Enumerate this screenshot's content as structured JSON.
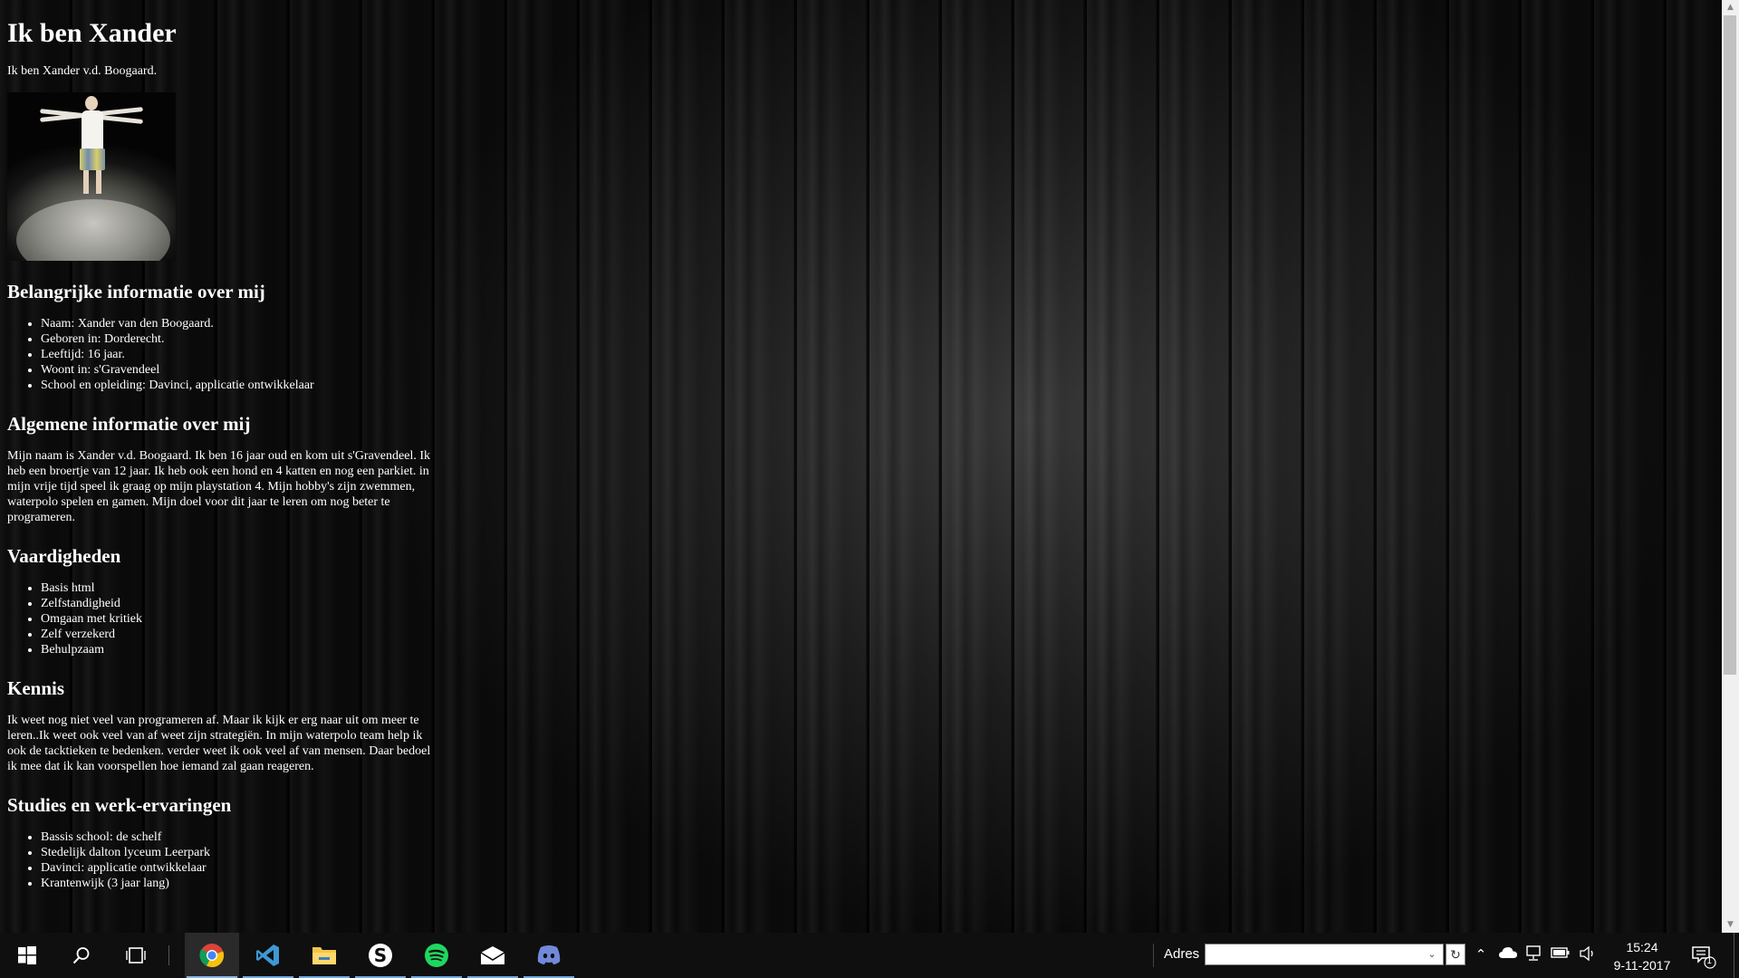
{
  "page": {
    "title": "Ik ben Xander",
    "intro": "Ik ben Xander v.d. Boogaard.",
    "sections": {
      "belangrijk": {
        "heading": "Belangrijke informatie over mij",
        "items": [
          "Naam: Xander van den Boogaard.",
          "Geboren in: Dorderecht.",
          "Leeftijd: 16 jaar.",
          "Woont in: s'Gravendeel",
          "School en opleiding: Davinci, applicatie ontwikkelaar"
        ]
      },
      "algemeen": {
        "heading": "Algemene informatie over mij",
        "text": "Mijn naam is Xander v.d. Boogaard. Ik ben 16 jaar oud en kom uit s'Gravendeel. Ik heb een broertje van 12 jaar. Ik heb ook een hond en 4 katten en nog een parkiet. in mijn vrije tijd speel ik graag op mijn playstation 4. Mijn hobby's zijn zwemmen, waterpolo spelen en gamen. Mijn doel voor dit jaar te leren om nog beter te programeren."
      },
      "vaardigheden": {
        "heading": "Vaardigheden",
        "items": [
          "Basis html",
          "Zelfstandigheid",
          "Omgaan met kritiek",
          "Zelf verzekerd",
          "Behulpzaam"
        ]
      },
      "kennis": {
        "heading": "Kennis",
        "text": "Ik weet nog niet veel van programeren af. Maar ik kijk er erg naar uit om meer te leren..Ik weet ook veel van af weet zijn strategiën. In mijn waterpolo team help ik ook de tacktieken te bedenken. verder weet ik ook veel af van mensen. Daar bedoel ik mee dat ik kan voorspellen hoe iemand zal gaan reageren."
      },
      "studies": {
        "heading": "Studies en werk-ervaringen",
        "items": [
          "Bassis school: de schelf",
          "Stedelijk dalton lyceum Leerpark",
          "Davinci: applicatie ontwikkelaar",
          "Krantenwijk (3 jaar lang)"
        ]
      }
    }
  },
  "taskbar": {
    "apps": [
      {
        "icon": "windows-start-icon",
        "active": false
      },
      {
        "icon": "search-icon",
        "active": false
      },
      {
        "icon": "task-view-icon",
        "active": false
      },
      {
        "icon": "chrome-icon",
        "active": true
      },
      {
        "icon": "vscode-icon",
        "active": false
      },
      {
        "icon": "file-explorer-icon",
        "active": false
      },
      {
        "icon": "skype-icon",
        "active": false
      },
      {
        "icon": "spotify-icon",
        "active": false
      },
      {
        "icon": "mail-icon",
        "active": false
      },
      {
        "icon": "discord-icon",
        "active": false
      }
    ],
    "address_label": "Adres",
    "address_value": "",
    "clock_time": "15:24",
    "clock_date": "9-11-2017",
    "notification_count": "1"
  }
}
